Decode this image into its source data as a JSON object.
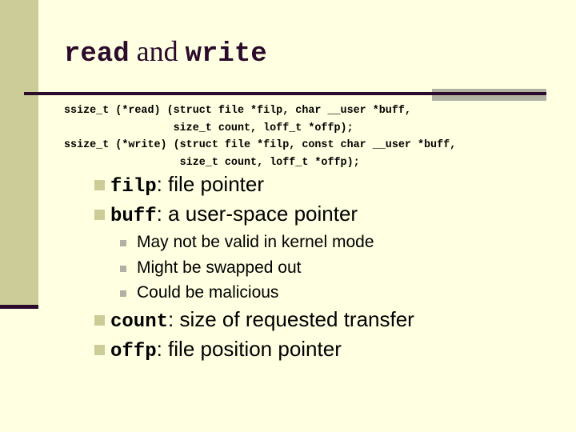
{
  "slide": {
    "title": {
      "part1": "read",
      "part2": " and ",
      "part3": "write"
    },
    "code_lines": [
      "ssize_t (*read) (struct file *filp, char __user *buff,",
      "                 size_t count, loff_t *offp);",
      "ssize_t (*write) (struct file *filp, const char __user *buff,",
      "                  size_t count, loff_t *offp);"
    ],
    "bullets": [
      {
        "keyword": "filp",
        "text": ": file pointer"
      },
      {
        "keyword": "buff",
        "text": ": a user-space pointer"
      },
      {
        "keyword": "count",
        "text": ": size of requested transfer"
      },
      {
        "keyword": "offp",
        "text": ": file position pointer"
      }
    ],
    "sub_bullets": [
      "May not be valid in kernel mode",
      "Might be swapped out",
      "Could be malicious"
    ]
  },
  "colors": {
    "background": "#ffffe1",
    "sidebar": "#cccc99",
    "accent_dark": "#2b0a2b",
    "accent_gray": "#b2b2a4"
  }
}
